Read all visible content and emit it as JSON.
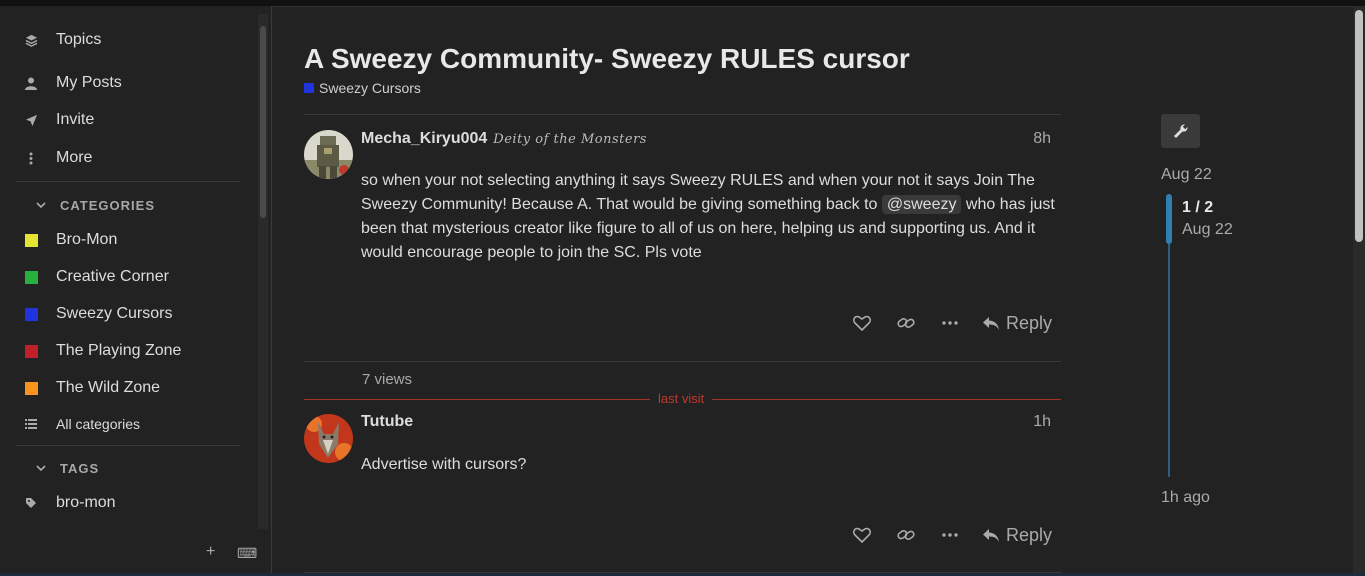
{
  "sidebar": {
    "nav": [
      {
        "label": "Topics",
        "icon": "layers-icon"
      },
      {
        "label": "My Posts",
        "icon": "user-icon"
      },
      {
        "label": "Invite",
        "icon": "paper-plane-icon"
      },
      {
        "label": "More",
        "icon": "vertical-ellipsis-icon"
      }
    ],
    "categories_header": "CATEGORIES",
    "categories": [
      {
        "label": "Bro-Mon",
        "color": "#e5e531"
      },
      {
        "label": "Creative Corner",
        "color": "#27b03d"
      },
      {
        "label": "Sweezy Cursors",
        "color": "#2233dd"
      },
      {
        "label": "The Playing Zone",
        "color": "#c0202a"
      },
      {
        "label": "The Wild Zone",
        "color": "#f7941d"
      }
    ],
    "all_categories": "All categories",
    "tags_header": "TAGS",
    "tags": [
      {
        "label": "bro-mon"
      }
    ],
    "footer": {
      "add": "+",
      "keyboard": "⌨"
    }
  },
  "topic": {
    "title": "A Sweezy Community- Sweezy RULES cursor",
    "category": {
      "label": "Sweezy Cursors",
      "color": "#2233dd"
    }
  },
  "posts": [
    {
      "username": "Mecha_Kiryu004",
      "user_title": "Deity of the Monsters",
      "time": "8h",
      "body_before": "so when your not selecting anything it says Sweezy RULES and when your not it says Join The Sweezy Community! Because A. That would be giving something back to ",
      "mention": "@sweezy",
      "body_after": " who has just been that mysterious creator like figure to all of us on here, helping us and supporting us. And it would encourage people to join the SC. Pls vote",
      "reply_label": "Reply"
    },
    {
      "username": "Tutube",
      "time": "1h",
      "body": "Advertise with cursors?",
      "reply_label": "Reply"
    }
  ],
  "views": "7 views",
  "last_visit": "last visit",
  "timeline": {
    "start_date": "Aug 22",
    "position": "1 / 2",
    "position_date": "Aug 22",
    "end": "1h ago"
  },
  "colors": {
    "accent": "#2f7fb0",
    "last_visit": "#c0392b"
  }
}
